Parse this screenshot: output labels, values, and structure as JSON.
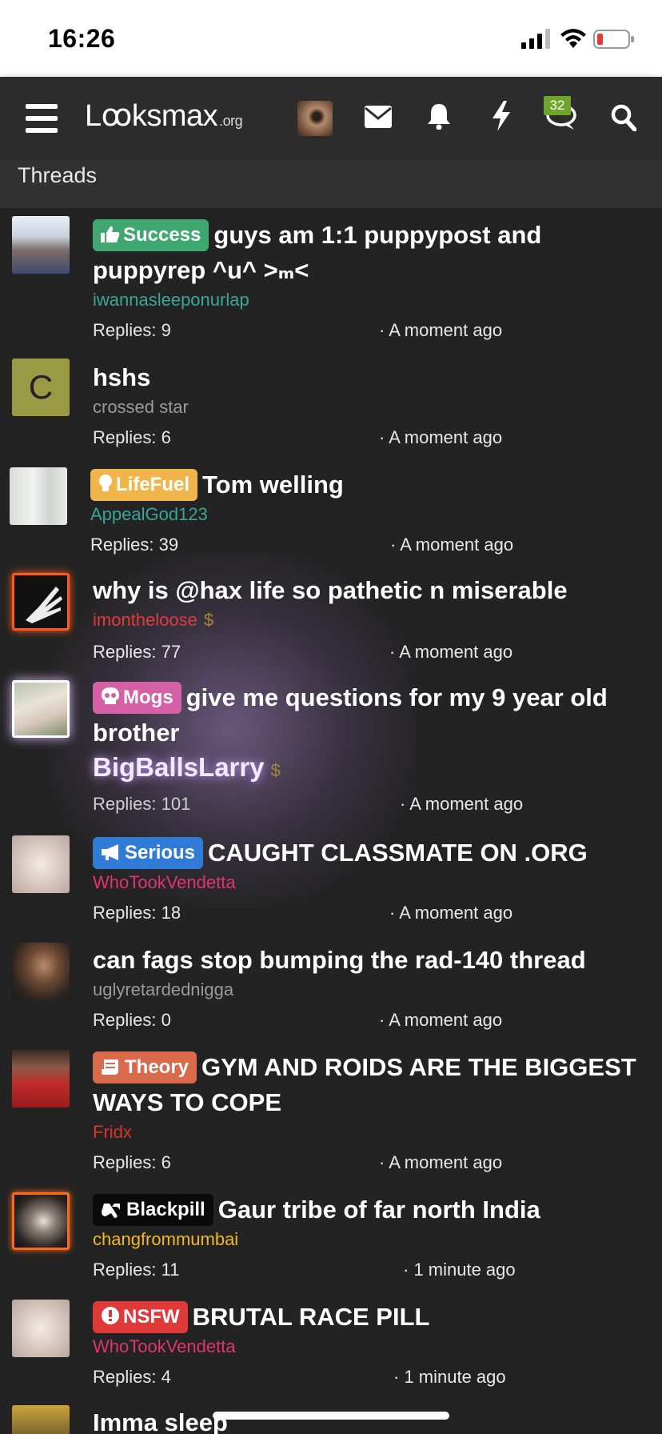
{
  "status_bar": {
    "time": "16:26"
  },
  "navbar": {
    "logo_text": "Lꝏksmax",
    "logo_suffix": ".org",
    "chat_badge": "32",
    "icons": [
      "hamburger-icon",
      "avatar",
      "mail-icon",
      "bell-icon",
      "bolt-icon",
      "chat-icon",
      "search-icon"
    ]
  },
  "section": {
    "title": "Threads"
  },
  "threads": [
    {
      "prefix": "Success",
      "prefix_color": "#3fa871",
      "title": "guys am 1:1 puppypost and puppyrep ^u^ >ₘ<",
      "author": "iwannasleeponurlap",
      "author_color": "#3aa696",
      "replies": "Replies: 9",
      "time": "· A moment ago"
    },
    {
      "prefix": "",
      "title": "hshs",
      "author": "crossed star",
      "author_color": "#9a9a9a",
      "avatar_letter": "C",
      "replies": "Replies: 6",
      "time": "· A moment ago"
    },
    {
      "prefix": "LifeFuel",
      "prefix_color": "#f0b64b",
      "title": "Tom welling",
      "author": "AppealGod123",
      "author_color": "#3aa696",
      "replies": "Replies: 39",
      "time": "· A moment ago"
    },
    {
      "prefix": "",
      "title": "why is @hax life so pathetic n miserable",
      "author": "imontheloose",
      "author_color": "#e03b3b",
      "dollar": "$",
      "replies": "Replies: 77",
      "time": "· A moment ago"
    },
    {
      "prefix": "Mogs",
      "prefix_color": "#d460a6",
      "title": "give me questions for my 9 year old brother",
      "author": "BigBallsLarry",
      "author_color": "#f4eaff",
      "dollar": "$",
      "replies": "Replies: 101",
      "time": "· A moment ago"
    },
    {
      "prefix": "Serious",
      "prefix_color": "#2f7bd6",
      "title": "CAUGHT CLASSMATE ON .ORG",
      "author": "WhoTookVendetta",
      "author_color": "#e0356e",
      "replies": "Replies: 18",
      "time": "· A moment ago"
    },
    {
      "prefix": "",
      "title": "can fags stop bumping the rad-140 thread",
      "author": "uglyretardednigga",
      "author_color": "#9a9a9a",
      "replies": "Replies: 0",
      "time": "· A moment ago"
    },
    {
      "prefix": "Theory",
      "prefix_color": "#d96a4c",
      "title": "GYM AND ROIDS ARE THE BIGGEST WAYS TO COPE",
      "author": "Fridx",
      "author_color": "#d9332f",
      "replies": "Replies: 6",
      "time": "· A moment ago"
    },
    {
      "prefix": "Blackpill",
      "prefix_color": "#0a0a0a",
      "title": "Gaur tribe of far north India",
      "author": "changfrommumbai",
      "author_color": "#f0b822",
      "replies": "Replies: 11",
      "time": "· 1 minute ago"
    },
    {
      "prefix": "NSFW",
      "prefix_color": "#e0393a",
      "title": "BRUTAL RACE PILL",
      "author": "WhoTookVendetta",
      "author_color": "#e0356e",
      "replies": "Replies: 4",
      "time": "· 1 minute ago"
    },
    {
      "prefix": "",
      "title": "Imma sleep",
      "author": "",
      "replies": "",
      "time": ""
    }
  ]
}
